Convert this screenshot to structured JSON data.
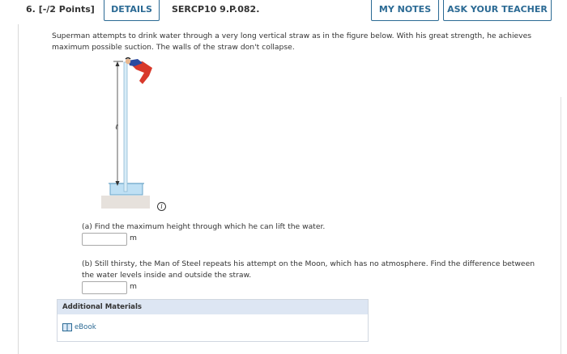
{
  "header": {
    "question_number": "6.",
    "points": "[-/2 Points]",
    "details_label": "DETAILS",
    "problem_code": "SERCP10 9.P.082.",
    "my_notes_label": "MY NOTES",
    "ask_teacher_label": "ASK YOUR TEACHER"
  },
  "question": {
    "prompt": "Superman attempts to drink water through a very long vertical straw as in the figure below. With his great strength, he achieves maximum possible suction. The walls of the straw don't collapse.",
    "figure_label": "ℓ",
    "info_icon": "i"
  },
  "parts": [
    {
      "text": "(a) Find the maximum height through which he can lift the water.",
      "value": "",
      "unit": "m"
    },
    {
      "text": "(b) Still thirsty, the Man of Steel repeats his attempt on the Moon, which has no atmosphere. Find the difference between the water levels inside and outside the straw.",
      "value": "",
      "unit": "m"
    }
  ],
  "materials": {
    "title": "Additional Materials",
    "ebook_label": "eBook"
  },
  "colors": {
    "accent": "#2b6a94",
    "materials_header": "#dde6f3",
    "water": "#bfe0f4",
    "cape": "#d8392b"
  }
}
